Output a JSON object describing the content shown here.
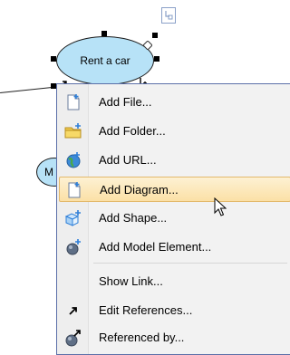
{
  "diagram": {
    "use_case_primary": "Rent a car",
    "use_case_secondary_partial": "M"
  },
  "context_menu": {
    "items": [
      {
        "label": "Add File...",
        "icon": "file-icon"
      },
      {
        "label": "Add Folder...",
        "icon": "folder-icon"
      },
      {
        "label": "Add URL...",
        "icon": "globe-icon"
      },
      {
        "label": "Add Diagram...",
        "icon": "diagram-icon",
        "highlighted": true
      },
      {
        "label": "Add Shape...",
        "icon": "shape-icon"
      },
      {
        "label": "Add Model Element...",
        "icon": "model-element-icon"
      },
      {
        "label": "Show Link...",
        "icon": ""
      },
      {
        "label": "Edit References...",
        "icon": "arrow-icon"
      },
      {
        "label": "Referenced by...",
        "icon": "referenced-icon"
      }
    ]
  },
  "colors": {
    "use_case_fill": "#b7e2f7",
    "menu_highlight": "#fbe0a6",
    "menu_border": "#5b6fa8"
  }
}
